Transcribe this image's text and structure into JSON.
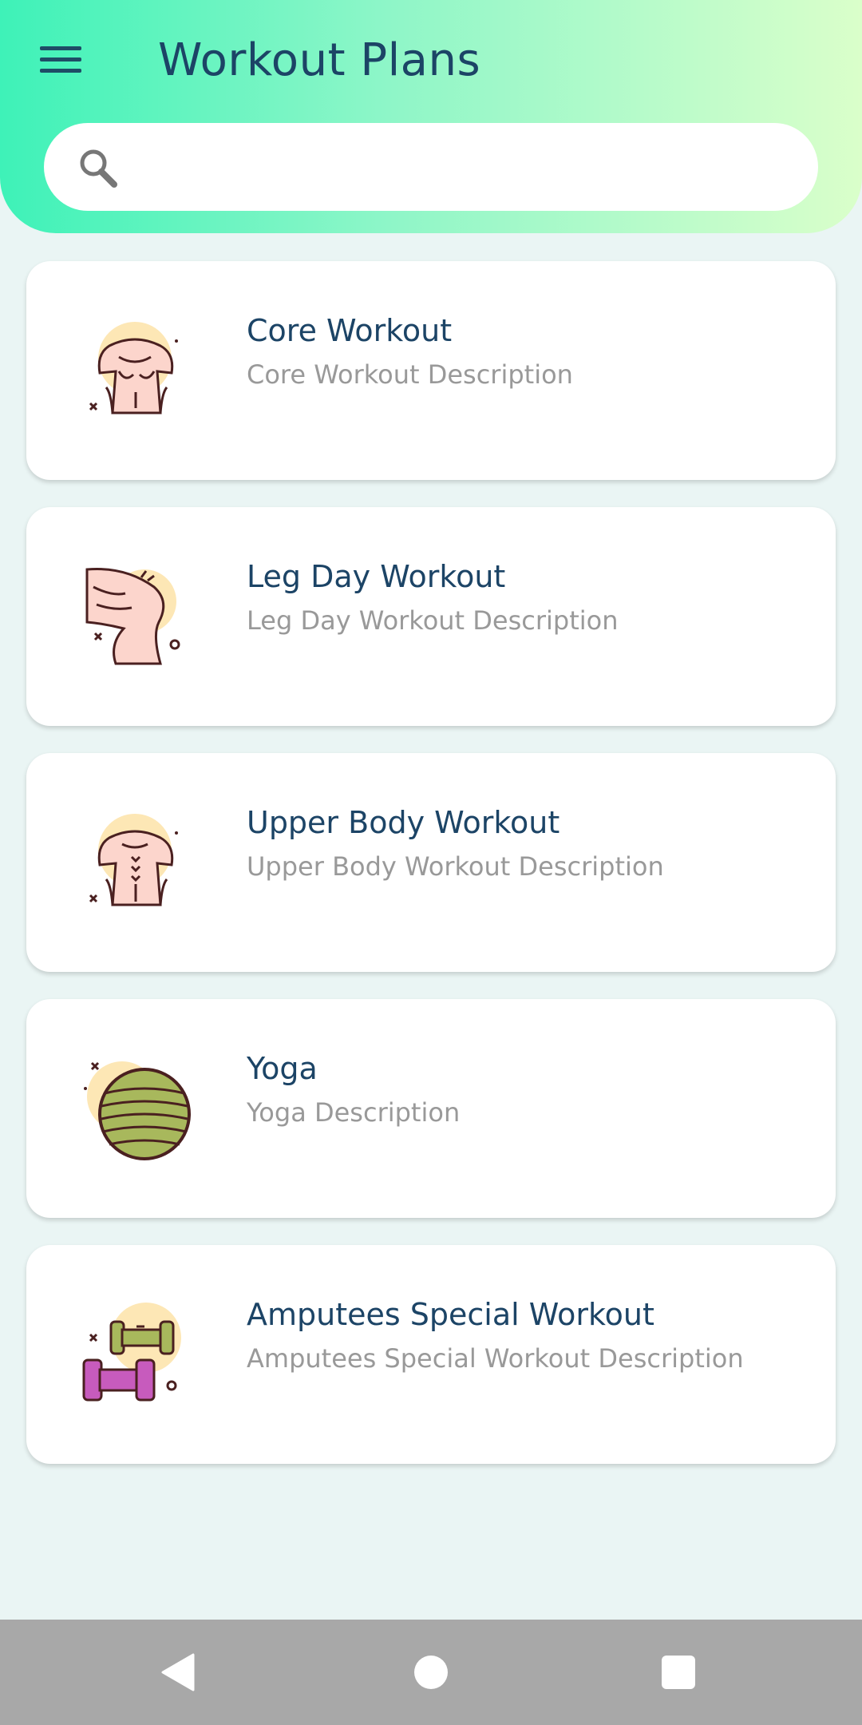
{
  "header": {
    "title": "Workout Plans",
    "menu_icon": "hamburger-menu-icon"
  },
  "search": {
    "placeholder": "",
    "value": "",
    "icon": "search-icon"
  },
  "workouts": [
    {
      "title": "Core Workout",
      "description": "Core Workout Description",
      "icon": "abs-torso-icon"
    },
    {
      "title": "Leg Day Workout",
      "description": "Leg Day Workout Description",
      "icon": "leg-muscle-icon"
    },
    {
      "title": "Upper Body Workout",
      "description": "Upper Body Workout Description",
      "icon": "back-torso-icon"
    },
    {
      "title": "Yoga",
      "description": "Yoga Description",
      "icon": "yoga-ball-icon"
    },
    {
      "title": "Amputees Special Workout",
      "description": "Amputees Special Workout Description",
      "icon": "dumbbells-icon"
    }
  ],
  "navbar": {
    "back_icon": "back-triangle-icon",
    "home_icon": "home-circle-icon",
    "recent_icon": "recent-apps-square-icon"
  },
  "colors": {
    "header_gradient_start": "#3ef2b8",
    "header_gradient_end": "#daffca",
    "background": "#eaf5f4",
    "title_text": "#1c4466",
    "description_text": "#999999",
    "navbar": "#a8a8a8"
  }
}
